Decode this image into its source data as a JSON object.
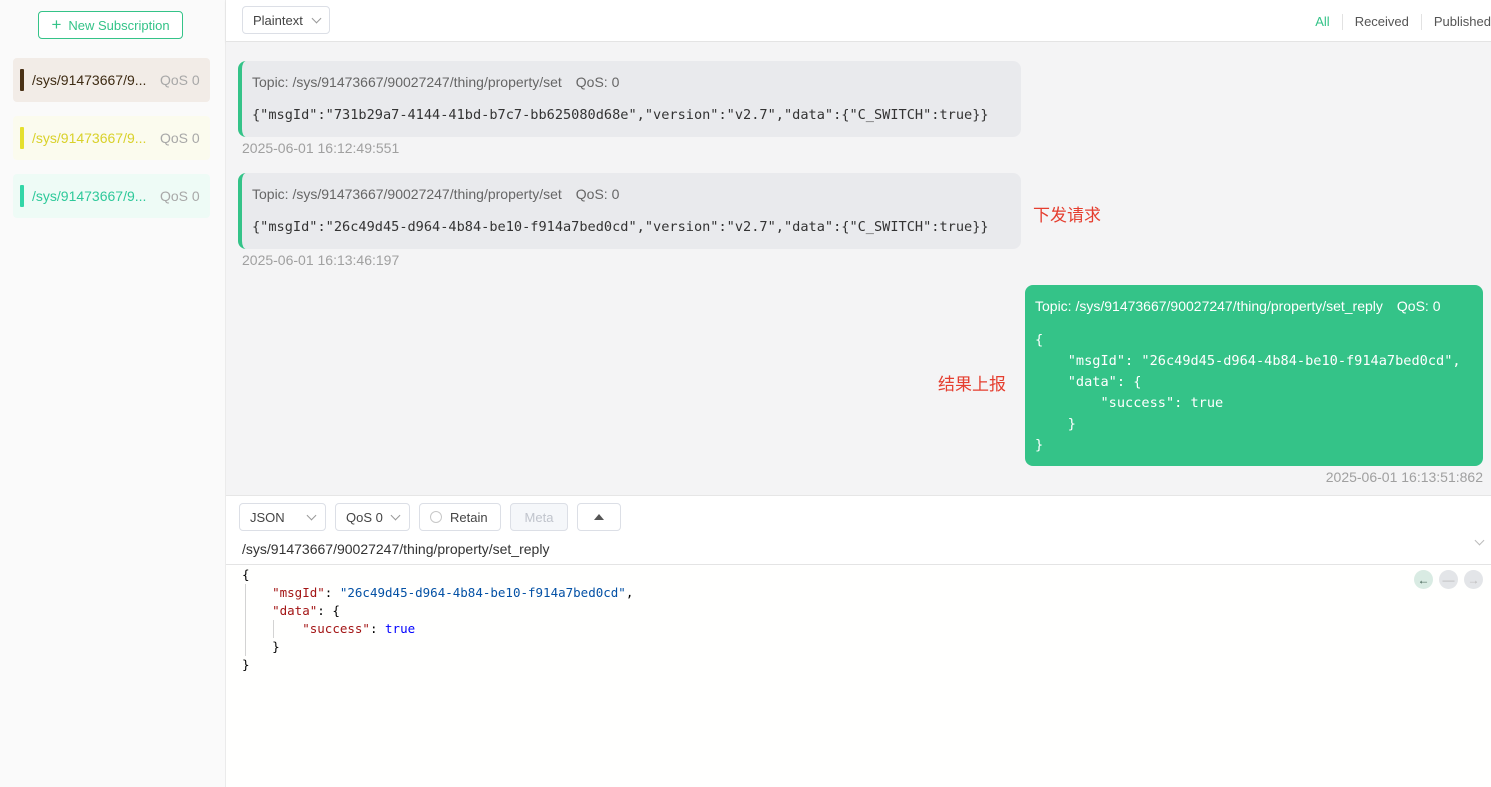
{
  "sidebar": {
    "new_subscription_label": "New Subscription",
    "subscriptions": [
      {
        "topic": "/sys/91473667/9...",
        "qos": "QoS 0",
        "color": "#4a3115",
        "bg": "#f2ece7",
        "text_color": "#3d2a12"
      },
      {
        "topic": "/sys/91473667/9...",
        "qos": "QoS 0",
        "color": "#e5e02e",
        "bg": "#fbfbee",
        "text_color": "#d9d12a"
      },
      {
        "topic": "/sys/91473667/9...",
        "qos": "QoS 0",
        "color": "#33d6a7",
        "bg": "#eefbf6",
        "text_color": "#2ec99a"
      }
    ]
  },
  "topbar": {
    "format": "Plaintext",
    "filters": [
      "All",
      "Received",
      "Published"
    ],
    "active_filter": "All"
  },
  "messages": [
    {
      "type": "received",
      "topic": "Topic: /sys/91473667/90027247/thing/property/set",
      "qos": "QoS: 0",
      "payload": "{\"msgId\":\"731b29a7-4144-41bd-b7c7-bb625080d68e\",\"version\":\"v2.7\",\"data\":{\"C_SWITCH\":true}}",
      "time": "2025-06-01 16:12:49:551"
    },
    {
      "type": "received",
      "topic": "Topic: /sys/91473667/90027247/thing/property/set",
      "qos": "QoS: 0",
      "payload": "{\"msgId\":\"26c49d45-d964-4b84-be10-f914a7bed0cd\",\"version\":\"v2.7\",\"data\":{\"C_SWITCH\":true}}",
      "time": "2025-06-01 16:13:46:197",
      "annotation": "下发请求"
    },
    {
      "type": "published",
      "topic": "Topic: /sys/91473667/90027247/thing/property/set_reply",
      "qos": "QoS: 0",
      "payload": "{\n    \"msgId\": \"26c49d45-d964-4b84-be10-f914a7bed0cd\",\n    \"data\": {\n        \"success\": true\n    }\n}",
      "time": "2025-06-01 16:13:51:862",
      "annotation": "结果上报"
    }
  ],
  "publisher": {
    "format": "JSON",
    "qos": "QoS 0",
    "retain_label": "Retain",
    "meta_label": "Meta",
    "topic": "/sys/91473667/90027247/thing/property/set_reply",
    "editor": {
      "msgId_key": "\"msgId\"",
      "msgId_value": "\"26c49d45-d964-4b84-be10-f914a7bed0cd\"",
      "data_key": "\"data\"",
      "success_key": "\"success\"",
      "success_value": "true"
    },
    "history_icons": [
      "arrow-left-icon",
      "minus-icon",
      "arrow-right-icon"
    ]
  }
}
